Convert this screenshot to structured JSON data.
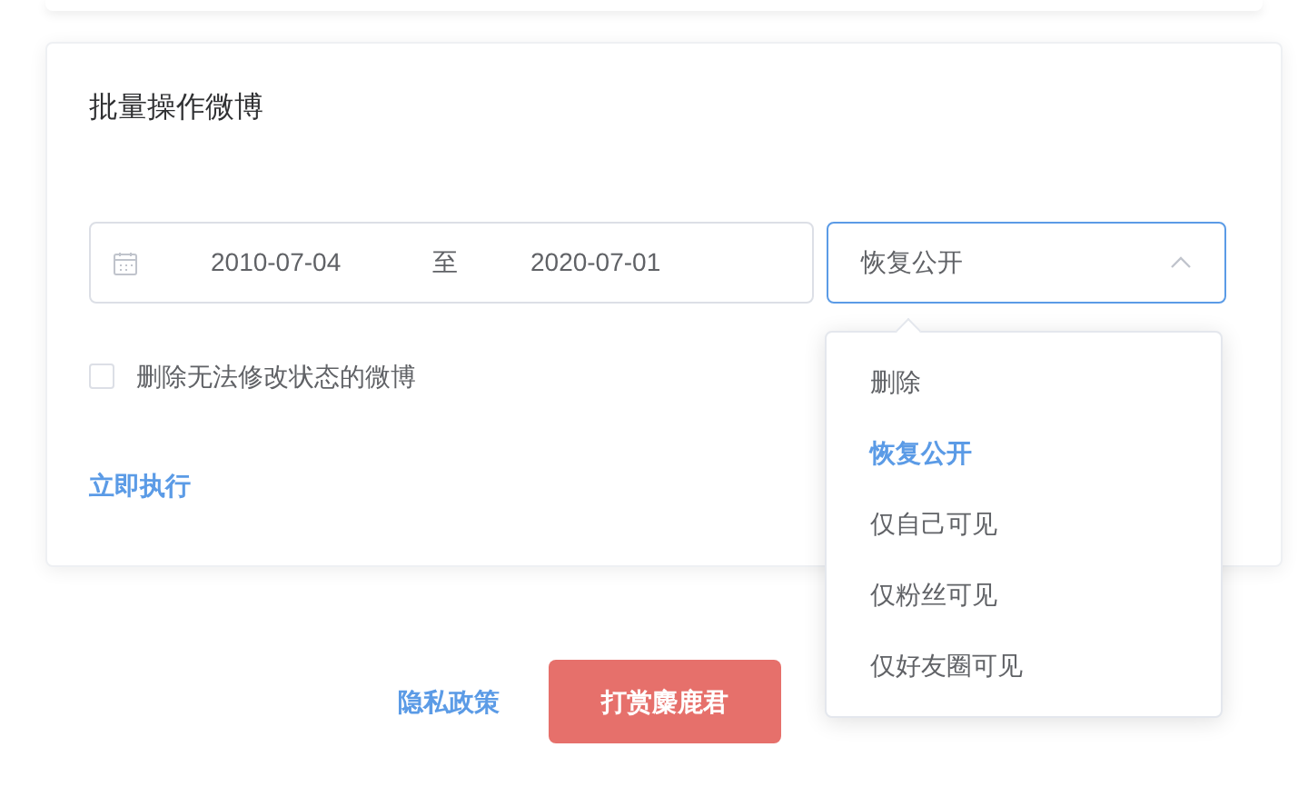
{
  "card": {
    "title": "批量操作微博",
    "date_range": {
      "start": "2010-07-04",
      "separator": "至",
      "end": "2020-07-01"
    },
    "select": {
      "value": "恢复公开",
      "expanded": true,
      "options": [
        {
          "label": "删除",
          "selected": false
        },
        {
          "label": "恢复公开",
          "selected": true
        },
        {
          "label": "仅自己可见",
          "selected": false
        },
        {
          "label": "仅粉丝可见",
          "selected": false
        },
        {
          "label": "仅好友圈可见",
          "selected": false
        }
      ]
    },
    "checkbox": {
      "label": "删除无法修改状态的微博",
      "checked": false
    },
    "action_link": "立即执行"
  },
  "footer": {
    "privacy_link": "隐私政策",
    "donate_button": "打赏麋鹿君"
  }
}
